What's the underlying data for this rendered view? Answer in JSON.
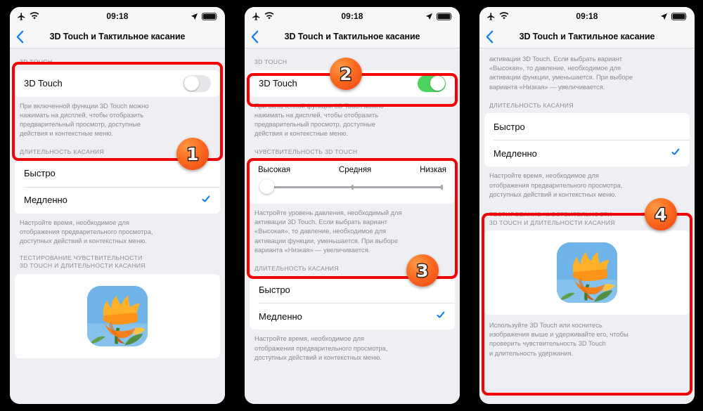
{
  "statusbar": {
    "time": "09:18",
    "icons": {
      "airplane": "airplane-mode-icon",
      "wifi": "wifi-icon",
      "location": "location-arrow-icon",
      "battery": "battery-icon"
    }
  },
  "navbar": {
    "title": "3D Touch и Тактильное касание",
    "back": "back-chevron-icon"
  },
  "sections": {
    "touch3d_header": "3D TOUCH",
    "touch3d_row": "3D Touch",
    "touch3d_note": "При включенной функции 3D Touch можно\nнажимать на дисплей, чтобы отобразить\nпредварительный просмотр, доступные\nдействия и контекстные меню.",
    "sensitivity_header": "ЧУВСТВИТЕЛЬНОСТЬ 3D TOUCH",
    "sensitivity_high": "Высокая",
    "sensitivity_medium": "Средняя",
    "sensitivity_low": "Низкая",
    "sensitivity_note": "Настройте уровень давления, необходимый для\nактивации 3D Touch. Если выбрать вариант\n«Высокая», то давление, необходимое для\nактивации функции, уменьшается. При выборе\nварианта «Низкая» — увеличивается.",
    "sensitivity_note_tail": "активации 3D Touch. Если выбрать вариант\n«Высокая», то давление, необходимое для\nактивации функции, уменьшается. При выборе\nварианта «Низкая» — увеличивается.",
    "duration_header": "ДЛИТЕЛЬНОСТЬ КАСАНИЯ",
    "duration_fast": "Быстро",
    "duration_slow": "Медленно",
    "duration_note": "Настройте время, необходимое для\nотображения предварительного просмотра,\nдоступных действий и контекстных меню.",
    "test_header": "ТЕСТИРОВАНИЕ ЧУВСТВИТЕЛЬНОСТИ\n3D TOUCH И ДЛИТЕЛЬНОСТИ КАСАНИЯ",
    "test_note": "Используйте 3D Touch или коснитесь\nизображения выше и удерживайте его, чтобы\nпроверить чувствительность 3D Touch\nи длительность удержания."
  },
  "state": {
    "touch3d_off": false,
    "touch3d_on": true,
    "duration_selected": "Медленно",
    "sensitivity_selected": "Высокая"
  },
  "annotations": {
    "b1": "1",
    "b2": "2",
    "b3": "3",
    "b4": "4"
  },
  "colors": {
    "highlight": "#f40000",
    "badge": "#fb6d22",
    "toggle_on": "#4cd35f",
    "accent_blue": "#0a7cf4"
  }
}
